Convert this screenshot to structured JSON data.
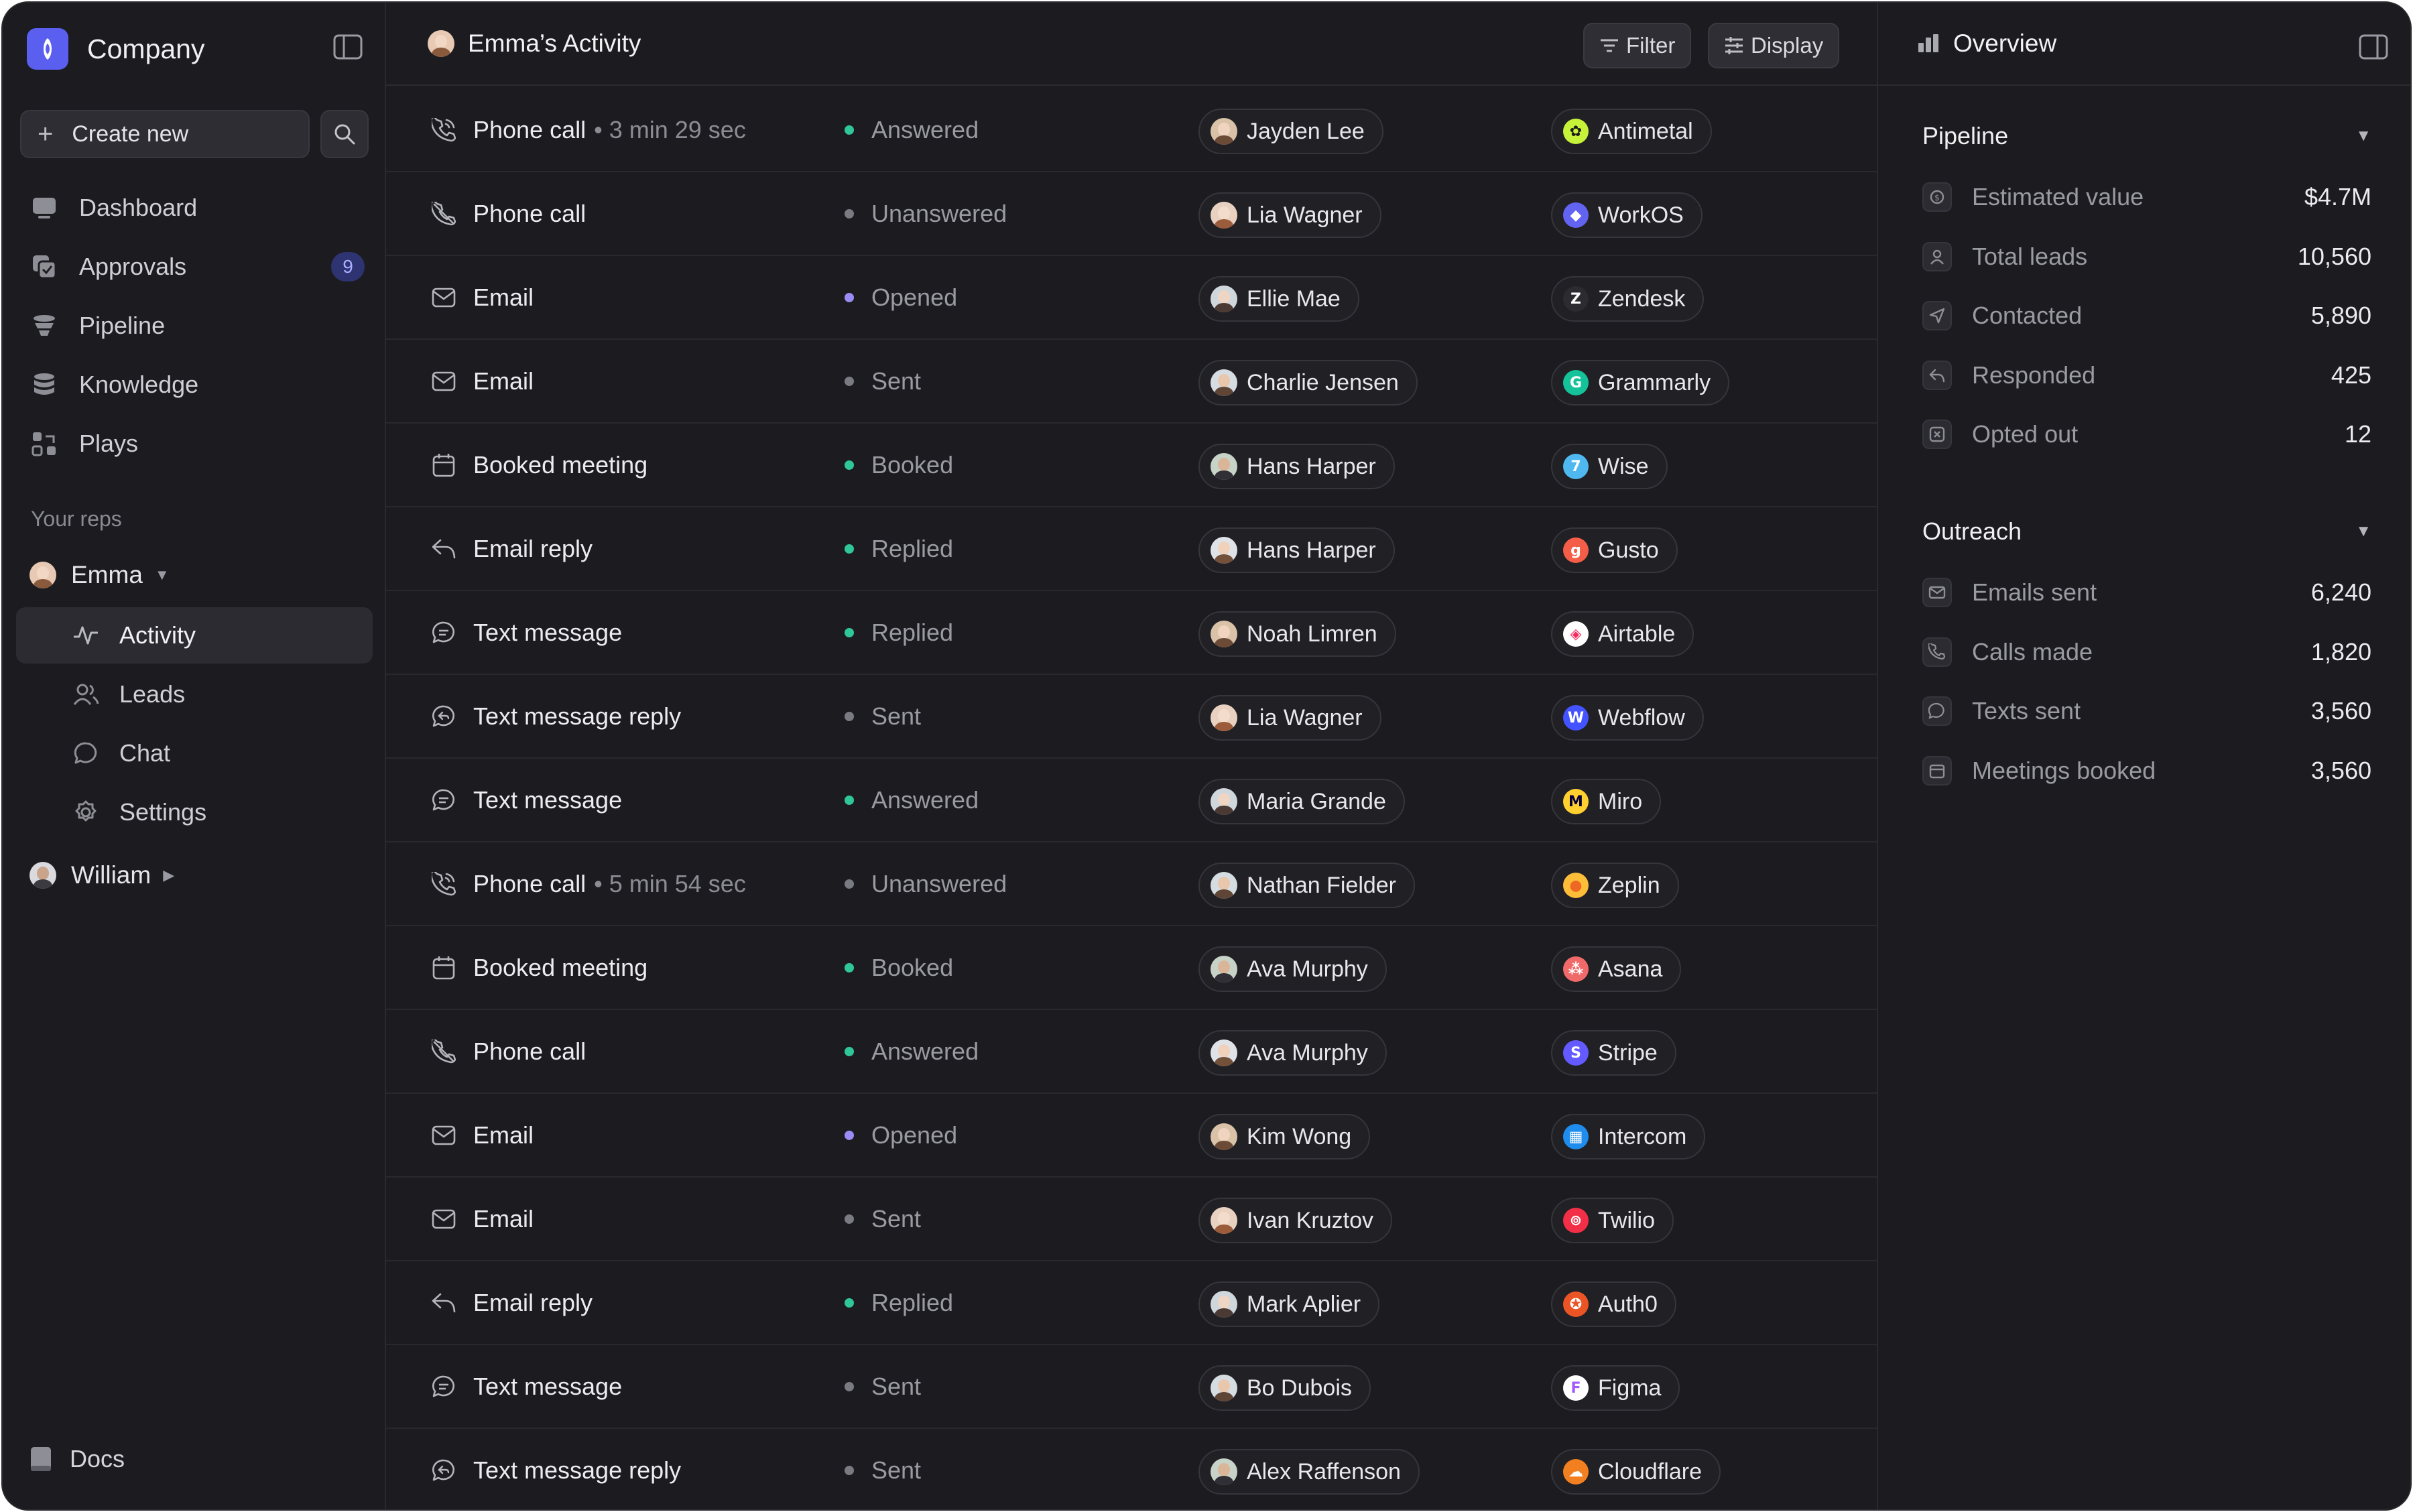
{
  "colors": {
    "window_bg": "#1c1c20",
    "accent": "#5b5ff0",
    "status_green": "#2fc79a",
    "status_gray": "#7a7a82",
    "status_purple": "#9a8cf5"
  },
  "sidebar": {
    "company_name": "Company",
    "create_new_label": "Create new",
    "nav": [
      {
        "label": "Dashboard",
        "icon": "dashboard-icon"
      },
      {
        "label": "Approvals",
        "icon": "approvals-icon",
        "badge": "9"
      },
      {
        "label": "Pipeline",
        "icon": "pipeline-icon"
      },
      {
        "label": "Knowledge",
        "icon": "database-icon"
      },
      {
        "label": "Plays",
        "icon": "plays-icon"
      }
    ],
    "reps_section_label": "Your reps",
    "reps": [
      {
        "name": "Emma",
        "expanded": true
      },
      {
        "name": "William",
        "expanded": false
      }
    ],
    "emma_items": [
      {
        "label": "Activity",
        "icon": "activity-icon",
        "active": true
      },
      {
        "label": "Leads",
        "icon": "users-icon"
      },
      {
        "label": "Chat",
        "icon": "chat-icon"
      },
      {
        "label": "Settings",
        "icon": "gear-icon"
      }
    ],
    "docs_label": "Docs"
  },
  "main": {
    "title": "Emma’s Activity",
    "filter_label": "Filter",
    "display_label": "Display",
    "rows": [
      {
        "type": "Phone call",
        "icon": "phone",
        "duration": "• 3 min 29 sec",
        "status": "Answered",
        "status_color": "#2fc79a",
        "person": "Jayden Lee",
        "company": "Antimetal",
        "logo_bg": "#c7f23a",
        "logo_fg": "#1a1a1a",
        "logo_glyph": "✿"
      },
      {
        "type": "Phone call",
        "icon": "phone-missed",
        "duration": "",
        "status": "Unanswered",
        "status_color": "#7a7a82",
        "person": "Lia Wagner",
        "company": "WorkOS",
        "logo_bg": "#6363f1",
        "logo_fg": "#ffffff",
        "logo_glyph": "◆"
      },
      {
        "type": "Email",
        "icon": "mail",
        "duration": "",
        "status": "Opened",
        "status_color": "#9a8cf5",
        "person": "Ellie Mae",
        "company": "Zendesk",
        "logo_bg": "#2c2c30",
        "logo_fg": "#ffffff",
        "logo_glyph": "Z"
      },
      {
        "type": "Email",
        "icon": "mail",
        "duration": "",
        "status": "Sent",
        "status_color": "#7a7a82",
        "person": "Charlie Jensen",
        "company": "Grammarly",
        "logo_bg": "#15c39a",
        "logo_fg": "#ffffff",
        "logo_glyph": "G"
      },
      {
        "type": "Booked meeting",
        "icon": "calendar",
        "duration": "",
        "status": "Booked",
        "status_color": "#2fc79a",
        "person": "Hans Harper",
        "company": "Wise",
        "logo_bg": "#4fb8f0",
        "logo_fg": "#ffffff",
        "logo_glyph": "7"
      },
      {
        "type": "Email reply",
        "icon": "reply",
        "duration": "",
        "status": "Replied",
        "status_color": "#2fc79a",
        "person": "Hans Harper",
        "company": "Gusto",
        "logo_bg": "#f45d48",
        "logo_fg": "#ffffff",
        "logo_glyph": "g"
      },
      {
        "type": "Text message",
        "icon": "message",
        "duration": "",
        "status": "Replied",
        "status_color": "#2fc79a",
        "person": "Noah Limren",
        "company": "Airtable",
        "logo_bg": "#ffffff",
        "logo_fg": "#f82b60",
        "logo_glyph": "◈"
      },
      {
        "type": "Text message reply",
        "icon": "message-reply",
        "duration": "",
        "status": "Sent",
        "status_color": "#7a7a82",
        "person": "Lia Wagner",
        "company": "Webflow",
        "logo_bg": "#4353ff",
        "logo_fg": "#ffffff",
        "logo_glyph": "W"
      },
      {
        "type": "Text message",
        "icon": "message",
        "duration": "",
        "status": "Answered",
        "status_color": "#2fc79a",
        "person": "Maria Grande",
        "company": "Miro",
        "logo_bg": "#ffd02f",
        "logo_fg": "#050038",
        "logo_glyph": "M"
      },
      {
        "type": "Phone call",
        "icon": "phone",
        "duration": "• 5 min 54 sec",
        "status": "Unanswered",
        "status_color": "#7a7a82",
        "person": "Nathan Fielder",
        "company": "Zeplin",
        "logo_bg": "#fdbd39",
        "logo_fg": "#ee6723",
        "logo_glyph": "●"
      },
      {
        "type": "Booked meeting",
        "icon": "calendar",
        "duration": "",
        "status": "Booked",
        "status_color": "#2fc79a",
        "person": "Ava Murphy",
        "company": "Asana",
        "logo_bg": "#f06a6a",
        "logo_fg": "#ffffff",
        "logo_glyph": "⁂"
      },
      {
        "type": "Phone call",
        "icon": "phone-missed",
        "duration": "",
        "status": "Answered",
        "status_color": "#2fc79a",
        "person": "Ava Murphy",
        "company": "Stripe",
        "logo_bg": "#635bff",
        "logo_fg": "#ffffff",
        "logo_glyph": "S"
      },
      {
        "type": "Email",
        "icon": "mail",
        "duration": "",
        "status": "Opened",
        "status_color": "#9a8cf5",
        "person": "Kim Wong",
        "company": "Intercom",
        "logo_bg": "#1f8ded",
        "logo_fg": "#ffffff",
        "logo_glyph": "▦"
      },
      {
        "type": "Email",
        "icon": "mail",
        "duration": "",
        "status": "Sent",
        "status_color": "#7a7a82",
        "person": "Ivan Kruztov",
        "company": "Twilio",
        "logo_bg": "#f22f46",
        "logo_fg": "#ffffff",
        "logo_glyph": "⊚"
      },
      {
        "type": "Email reply",
        "icon": "reply",
        "duration": "",
        "status": "Replied",
        "status_color": "#2fc79a",
        "person": "Mark Aplier",
        "company": "Auth0",
        "logo_bg": "#eb5424",
        "logo_fg": "#ffffff",
        "logo_glyph": "✪"
      },
      {
        "type": "Text message",
        "icon": "message",
        "duration": "",
        "status": "Sent",
        "status_color": "#7a7a82",
        "person": "Bo Dubois",
        "company": "Figma",
        "logo_bg": "#ffffff",
        "logo_fg": "#a259ff",
        "logo_glyph": "F"
      },
      {
        "type": "Text message reply",
        "icon": "message-reply",
        "duration": "",
        "status": "Sent",
        "status_color": "#7a7a82",
        "person": "Alex Raffenson",
        "company": "Cloudflare",
        "logo_bg": "#f38020",
        "logo_fg": "#ffffff",
        "logo_glyph": "☁"
      }
    ]
  },
  "panel": {
    "title": "Overview",
    "pipeline": {
      "title": "Pipeline",
      "stats": [
        {
          "label": "Estimated value",
          "value": "$4.7M",
          "icon": "dollar-icon"
        },
        {
          "label": "Total leads",
          "value": "10,560",
          "icon": "user-icon"
        },
        {
          "label": "Contacted",
          "value": "5,890",
          "icon": "send-icon"
        },
        {
          "label": "Responded",
          "value": "425",
          "icon": "reply-icon"
        },
        {
          "label": "Opted out",
          "value": "12",
          "icon": "opt-out-icon"
        }
      ]
    },
    "outreach": {
      "title": "Outreach",
      "stats": [
        {
          "label": "Emails sent",
          "value": "6,240",
          "icon": "mail-icon"
        },
        {
          "label": "Calls made",
          "value": "1,820",
          "icon": "phone-icon"
        },
        {
          "label": "Texts sent",
          "value": "3,560",
          "icon": "message-icon"
        },
        {
          "label": "Meetings booked",
          "value": "3,560",
          "icon": "calendar-icon"
        }
      ]
    }
  }
}
